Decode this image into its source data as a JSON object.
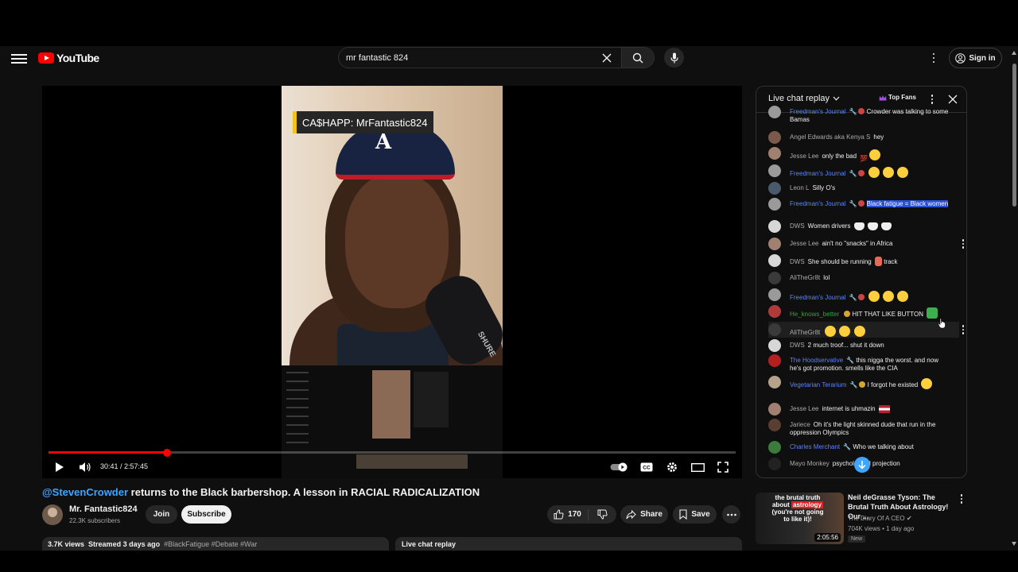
{
  "header": {
    "logo_text": "YouTube",
    "search_value": "mr fantastic 824",
    "sign_in_label": "Sign in"
  },
  "player": {
    "overlay_banner": "CA$HAPP: MrFantastic824",
    "mic_brand": "SHURE",
    "cap_logo": "A",
    "time_current": "30:41",
    "time_total": "2:57:45",
    "time_display": "30:41 / 2:57:45",
    "progress": 0.1728
  },
  "video": {
    "title_mention": "@StevenCrowder",
    "title_rest": " returns to the Black barbershop. A lesson in RACIAL RADICALIZATION",
    "channel_name": "Mr. Fantastic824",
    "subscribers": "22.3K subscribers",
    "join_label": "Join",
    "subscribe_label": "Subscribe",
    "like_count": "170",
    "share_label": "Share",
    "save_label": "Save",
    "desc_views": "3.7K views",
    "desc_streamed": "Streamed 3 days ago",
    "desc_tags": "#BlackFatigue #Debate #War",
    "chat_replay_label": "Live chat replay"
  },
  "chat": {
    "title": "Live chat replay",
    "top_fans_label": "Top Fans",
    "messages": [
      {
        "author": "Freedman's Journal",
        "text": "Crowder was talking to some Bamas"
      },
      {
        "author": "Angel Edwards aka Kenya S",
        "text": "hey"
      },
      {
        "author": "Jesse Lee",
        "text": "only the bad"
      },
      {
        "author": "Freedman's Journal",
        "text": ""
      },
      {
        "author": "Leon L",
        "text": "Silly O's"
      },
      {
        "author": "Freedman's Journal",
        "text": "Black fatigue = Black women"
      },
      {
        "author": "DWS",
        "text": "Women drivers"
      },
      {
        "author": "Jesse Lee",
        "text": "ain't no \"snacks\" in Africa"
      },
      {
        "author": "DWS",
        "text": "She should be running",
        "text2": "track"
      },
      {
        "author": "AliTheGr8t",
        "text": "lol"
      },
      {
        "author": "Freedman's Journal",
        "text": ""
      },
      {
        "author": "He_knows_better",
        "text": "HIT THAT LIKE BUTTON"
      },
      {
        "author": "AliTheGr8t",
        "text": ""
      },
      {
        "author": "DWS",
        "text": "2 much troof... shut it down"
      },
      {
        "author": "The Hoodservative",
        "text": "this nigga the worst. and now he's got promotion. smells like the CIA"
      },
      {
        "author": "Vegetarian Terarium",
        "text": "I forgot he existed"
      },
      {
        "author": "Jesse Lee",
        "text": "internet is uhmazin"
      },
      {
        "author": "Jariece",
        "text": "Oh it's the light skinned dude that run in the oppression Olympics"
      },
      {
        "author": "Charles Merchant",
        "text": "Who we talking about"
      },
      {
        "author": "Mayo Monkey",
        "text": "psychological projection"
      }
    ]
  },
  "recommendation": {
    "thumb_text_1": "the brutal truth about",
    "thumb_text_highlight": "astrology",
    "thumb_text_2": "(you're not going to like it)!",
    "duration": "2:05:56",
    "title": "Neil deGrasse Tyson: The Brutal Truth About Astrology! Our ...",
    "channel": "The Diary Of A CEO",
    "meta": "704K views • 1 day ago",
    "badge": "New"
  },
  "colors": {
    "background": "#0f0f0f",
    "accent_red": "#ff0000",
    "link_blue": "#3ea6ff",
    "moderator_blue": "#5e84f1",
    "member_green": "#2ba640"
  },
  "icons": [
    "menu-icon",
    "youtube-logo-icon",
    "clear-icon",
    "search-icon",
    "mic-icon",
    "more-icon",
    "user-icon",
    "play-icon",
    "volume-icon",
    "autoplay-toggle-icon",
    "captions-icon",
    "settings-icon",
    "theater-icon",
    "fullscreen-icon",
    "like-icon",
    "dislike-icon",
    "share-icon",
    "save-icon",
    "chevron-down-icon",
    "close-icon",
    "wrench-icon",
    "arrow-down-icon",
    "verified-icon"
  ]
}
